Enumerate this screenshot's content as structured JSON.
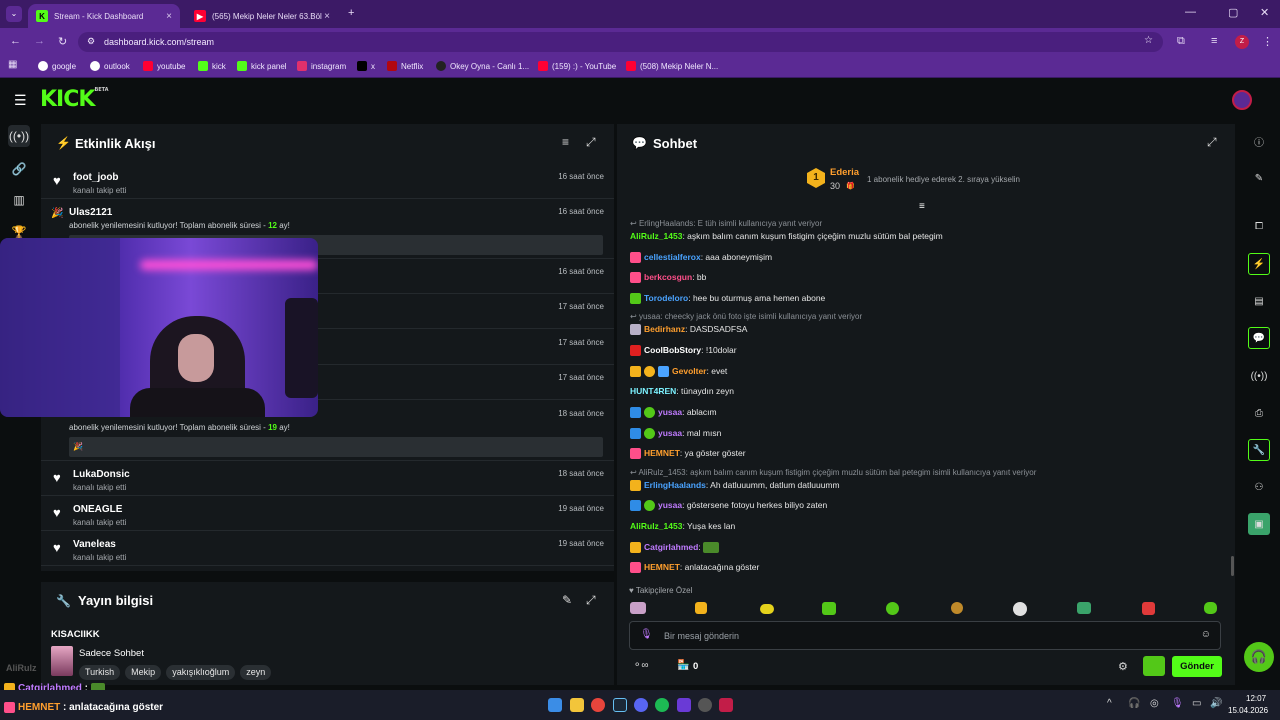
{
  "browser": {
    "tabs": [
      {
        "title": "Stream - Kick Dashboard",
        "active": true
      },
      {
        "title": "(565) Mekip Neler Neler 63.Böl",
        "active": false
      }
    ],
    "url": "dashboard.kick.com/stream",
    "profile_initial": "Z",
    "bookmarks": [
      "google",
      "outlook",
      "youtube",
      "kick",
      "kick panel",
      "instagram",
      "x",
      "Netflix",
      "Okey Oyna - Canlı 1...",
      "(159) :) - YouTube",
      "(508) Mekip Neler N..."
    ]
  },
  "app": {
    "logo": "KICK",
    "logo_badge": "BETA"
  },
  "activity": {
    "title": "Etkinlik Akışı",
    "items": [
      {
        "name": "foot_joob",
        "sub": "kanalı takip etti",
        "time": "16 saat önce"
      },
      {
        "name": "Ulas2121",
        "sub_prefix": "abonelik yenilemesini kutluyor! Toplam abonelik süresi - ",
        "months": "12",
        "sub_suffix": " ay!",
        "time": "16 saat önce"
      },
      {
        "time": "16 saat önce"
      },
      {
        "time": "17 saat önce"
      },
      {
        "time": "17 saat önce"
      },
      {
        "time": "17 saat önce"
      },
      {
        "sub_prefix": "abonelik yenilemesini kutluyor! Toplam abonelik süresi - ",
        "months": "19",
        "sub_suffix": " ay!",
        "time": "18 saat önce"
      },
      {
        "name": "LukaDonsic",
        "sub": "kanalı takip etti",
        "time": "18 saat önce"
      },
      {
        "name": "ONEAGLE",
        "sub": "kanalı takip etti",
        "time": "19 saat önce"
      },
      {
        "name": "Vaneleas",
        "sub": "kanalı takip etti",
        "time": "19 saat önce"
      }
    ]
  },
  "stream_info": {
    "title": "Yayın bilgisi",
    "stream_title": "KISACIIKK",
    "category": "Sadece Sohbet",
    "tags": [
      "Turkish",
      "Mekip",
      "yakışıklıoğlum",
      "zeyn"
    ]
  },
  "chat": {
    "title": "Sohbet",
    "leader": {
      "rank": "1",
      "name": "Ederia",
      "count": "30",
      "note": "1 abonelik hediye ederek 2. sıraya yükselin"
    },
    "messages": [
      {
        "reply": "ErlingHaalands: E tüh isimli kullanıcıya yanıt veriyor"
      },
      {
        "user": "AliRulz_1453",
        "color": "#53fc18",
        "text": ": aşkım balım canım kuşum fistigim çiçeğim muzlu sütüm bal petegim"
      },
      {
        "user": "cellestialferox",
        "color": "#4aa3ff",
        "text": ": aaa aboneymişim"
      },
      {
        "user": "berkcosgun",
        "color": "#ff4f8a",
        "text": ": bb"
      },
      {
        "user": "Torodeloro",
        "color": "#4aa3ff",
        "text": ": hee bu oturmuş ama hemen abone"
      },
      {
        "reply": "yusaa: cheecky jack önü foto işte isimli kullanıcıya yanıt veriyor"
      },
      {
        "user": "Bedirhanz",
        "color": "#ff9f2e",
        "text": ": DASDSADFSA"
      },
      {
        "user": "CoolBobStory",
        "color": "#ffffff",
        "text": ": !10dolar"
      },
      {
        "user": "Gevolter",
        "color": "#ff9f2e",
        "text": ": evet"
      },
      {
        "user": "HUNT4REN",
        "color": "#7cf2ff",
        "text": ": tünaydın zeyn"
      },
      {
        "user": "yusaa",
        "color": "#c07bff",
        "text": ": ablacım"
      },
      {
        "user": "yusaa",
        "color": "#c07bff",
        "text": ": mal mısn"
      },
      {
        "user": "HEMNET",
        "color": "#ff9f2e",
        "text": ": ya göster göster"
      },
      {
        "reply": "AliRulz_1453: aşkım balım canım kuşum fistigim çiçeğim muzlu sütüm bal petegim isimli kullanıcıya yanıt veriyor"
      },
      {
        "user": "ErlingHaalands",
        "color": "#4aa3ff",
        "text": ": Ah datluuumm, datlum datluuumm"
      },
      {
        "user": "yusaa",
        "color": "#c07bff",
        "text": ": göstersene fotoyu herkes biliyo zaten"
      },
      {
        "user": "AliRulz_1453",
        "color": "#53fc18",
        "text": ": Yuşa kes lan"
      },
      {
        "user": "Catgirlahmed",
        "color": "#c07bff",
        "text": ":"
      },
      {
        "user": "HEMNET",
        "color": "#ff9f2e",
        "text": ": anlatacağına göster"
      }
    ],
    "emote_section": "Takipçilere Özel",
    "input_placeholder": "Bir mesaj gönderin",
    "points": "0",
    "send_label": "Gönder"
  },
  "overlay": {
    "ghost_label": "AliRulz",
    "lines": [
      {
        "user": "Catgirlahmed",
        "text": " :"
      },
      {
        "user": "HEMNET",
        "text": " : anlatacağına göster"
      }
    ]
  },
  "taskbar": {
    "time": "12:07",
    "date": "15.04.2026"
  },
  "colors": {
    "brand": "#53fc18",
    "browser_frame": "#5b2a94",
    "panel": "#14181b"
  }
}
